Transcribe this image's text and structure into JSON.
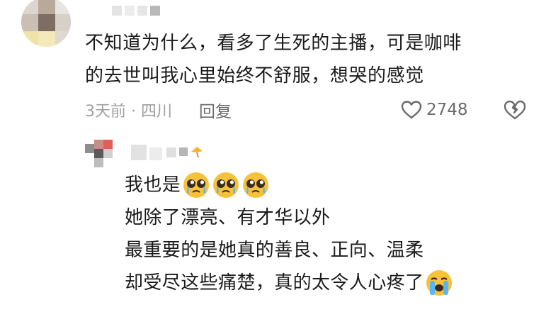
{
  "comment": {
    "lines": [
      "不知道为什么，看多了生死的主播，可是咖啡",
      "的去世叫我心里始终不舒服，想哭的感觉"
    ],
    "time_location": "3天前 · 四川",
    "reply_label": "回复",
    "like_count": "2748"
  },
  "reply": {
    "lines": [
      "我也是",
      "她除了漂亮、有才华以外",
      "最重要的是她真的善良、正向、温柔",
      "却受尽这些痛楚，真的太令人心疼了"
    ]
  },
  "icons": {
    "like": "heart-outline-icon",
    "dislike": "broken-heart-icon",
    "emoji_pleading": "pleading-face-emoji",
    "emoji_crying": "loudly-crying-face-emoji"
  },
  "colors": {
    "text": "#1a1a1a",
    "meta": "#a0a0a0",
    "icon": "#6b6b6b",
    "emoji": "#f7c23b"
  }
}
